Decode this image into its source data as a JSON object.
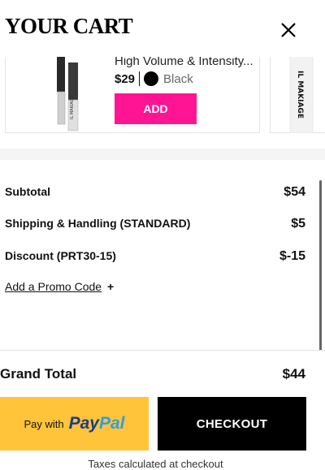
{
  "header": {
    "title": "YOUR CART"
  },
  "product": {
    "name": "High Volume & Intensity...",
    "price": "$29",
    "shade": "Black",
    "add_label": "ADD",
    "image_text": "IL MAKIAGE"
  },
  "next_product": {
    "image_text": "IL MAKIAGE"
  },
  "summary": {
    "subtotal_label": "Subtotal",
    "subtotal_value": "$54",
    "shipping_label": "Shipping & Handling (STANDARD)",
    "shipping_value": "$5",
    "discount_label": "Discount (PRT30-15)",
    "discount_value": "$-15",
    "promo_label": "Add a Promo Code",
    "promo_icon": "+"
  },
  "grand_total": {
    "label": "Grand Total",
    "value": "$44"
  },
  "paypal": {
    "pay_with": "Pay with",
    "logo_part1": "Pay",
    "logo_part2": "Pal"
  },
  "checkout_label": "CHECKOUT",
  "taxes_note": "Taxes calculated at checkout",
  "colors": {
    "accent_pink": "#ff1493",
    "paypal_yellow": "#ffc43a",
    "checkout_black": "#000000"
  }
}
